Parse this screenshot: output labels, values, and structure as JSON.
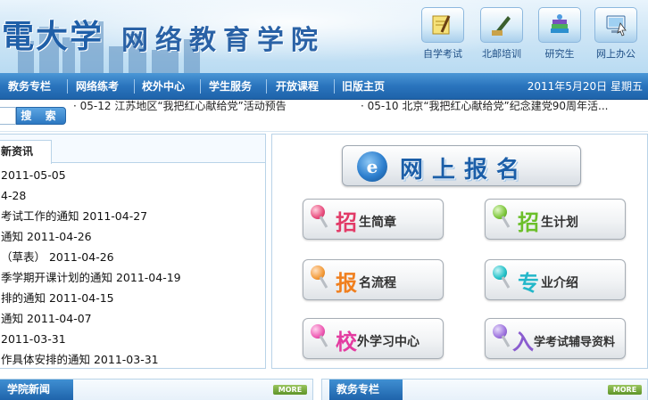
{
  "header": {
    "logo_left": "電大学",
    "logo_title": "网络教育学院",
    "quick_links": [
      {
        "label": "自学考试",
        "icon": "exam-icon"
      },
      {
        "label": "北邮培训",
        "icon": "quill-icon"
      },
      {
        "label": "研究生",
        "icon": "books-icon"
      },
      {
        "label": "网上办公",
        "icon": "computer-icon"
      }
    ]
  },
  "nav": {
    "items": [
      "教务专栏",
      "网络练考",
      "校外中心",
      "学生服务",
      "开放课程",
      "旧版主页"
    ],
    "date": "2011年5月20日  星期五"
  },
  "search": {
    "button_label": "搜 索",
    "placeholder": ""
  },
  "ticker": [
    "· 05-12 江苏地区“我把红心献给党”活动预告",
    "· 05-10 北京“我把红心献给党”纪念建党90周年活..."
  ],
  "news": {
    "tab_label": "新资讯",
    "items": [
      "2011-05-05",
      "4-28",
      "考试工作的通知  2011-04-27",
      "通知  2011-04-26",
      "（草表）  2011-04-26",
      "季学期开课计划的通知  2011-04-19",
      "排的通知  2011-04-15",
      "通知  2011-04-07",
      "2011-03-31",
      "作具体安排的通知  2011-03-31"
    ]
  },
  "panel": {
    "register": {
      "icon_letter": "e",
      "label": "网上报名"
    },
    "buttons": [
      {
        "big": "招",
        "rest": "生简章",
        "big_color": "#e23a67",
        "pin_color": "#e84d7e"
      },
      {
        "big": "招",
        "rest": "生计划",
        "big_color": "#6bbf2a",
        "pin_color": "#7cc63a"
      },
      {
        "big": "报",
        "rest": "名流程",
        "big_color": "#f07f1e",
        "pin_color": "#f39b3a"
      },
      {
        "big": "专",
        "rest": "业介绍",
        "big_color": "#23b7c9",
        "pin_color": "#22c1c8"
      },
      {
        "big": "校",
        "rest": "外学习中心",
        "big_color": "#e33ba0",
        "pin_color": "#ee5ab3"
      },
      {
        "big": "入",
        "rest": "学考试辅导资料",
        "big_color": "#8a5ccf",
        "pin_color": "#9d72de"
      }
    ]
  },
  "bottom": {
    "left_tab": "学院新闻",
    "right_tab": "教务专栏",
    "more_label": "MORE"
  }
}
